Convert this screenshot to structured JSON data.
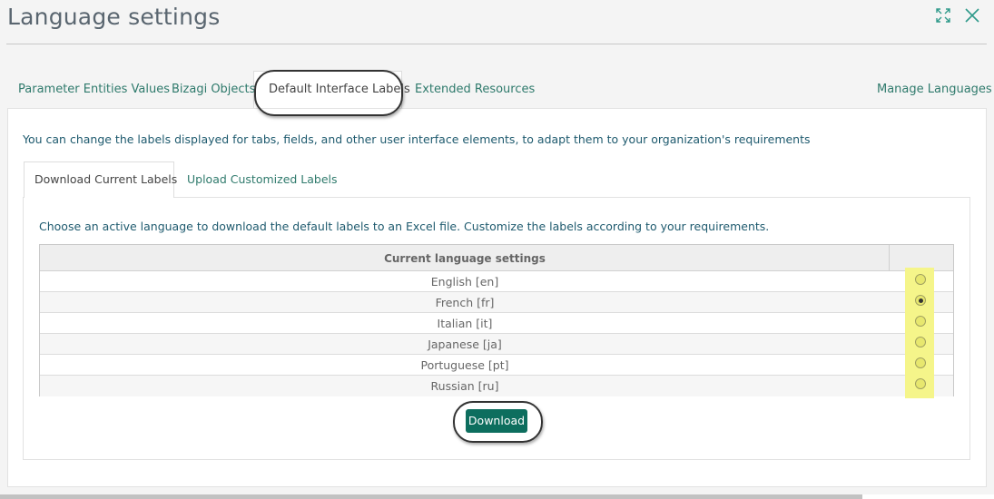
{
  "window": {
    "title": "Language settings",
    "maximize_icon": "expand-arrows-icon",
    "close_icon": "x-close-icon"
  },
  "top_tabs": [
    {
      "label": "Parameter Entities Values",
      "active": false
    },
    {
      "label": "Bizagi Objects",
      "active": false
    },
    {
      "label": "Default Interface Labels",
      "active": true
    },
    {
      "label": "Extended Resources",
      "active": false
    }
  ],
  "manage_languages": "Manage Languages",
  "description": "You can change the labels displayed for tabs, fields, and other user interface elements, to adapt them to your organization's requirements",
  "sub_tabs": [
    {
      "label": "Download Current Labels",
      "active": true
    },
    {
      "label": "Upload Customized Labels",
      "active": false
    }
  ],
  "instruction": "Choose an active language to download the default labels to an Excel file. Customize the labels according to your requirements.",
  "table": {
    "header": "Current language settings",
    "rows": [
      {
        "label": "English [en]",
        "selected": false
      },
      {
        "label": "French [fr]",
        "selected": true
      },
      {
        "label": "Italian [it]",
        "selected": false
      },
      {
        "label": "Japanese [ja]",
        "selected": false
      },
      {
        "label": "Portuguese [pt]",
        "selected": false
      },
      {
        "label": "Russian [ru]",
        "selected": false
      }
    ]
  },
  "download_label": "Download",
  "colors": {
    "accent": "#0d6e5e",
    "link": "#2f7a6c",
    "highlight": "#f5f58a"
  }
}
